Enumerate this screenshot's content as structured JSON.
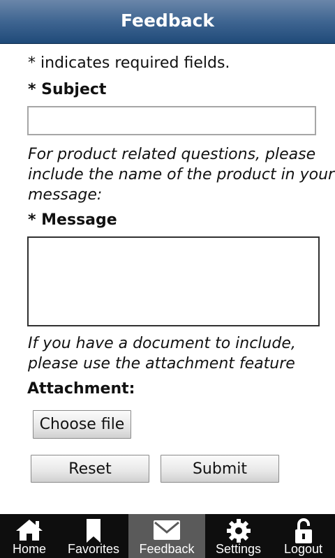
{
  "header": {
    "title": "Feedback"
  },
  "form": {
    "required_note": "* indicates required fields.",
    "subject_label": "* Subject",
    "subject_value": "",
    "product_hint": "For product related questions, please include the name of the product in your message:",
    "message_label": "* Message",
    "message_value": "",
    "document_hint": "If you have a document to include, please use the attachment feature below:",
    "attachment_label": "Attachment:",
    "choose_file_label": "Choose file",
    "reset_label": "Reset",
    "submit_label": "Submit"
  },
  "tabbar": {
    "active_tab": "Feedback",
    "items": [
      {
        "label": "Home",
        "icon": "home-icon"
      },
      {
        "label": "Favorites",
        "icon": "bookmark-icon"
      },
      {
        "label": "Feedback",
        "icon": "envelope-icon"
      },
      {
        "label": "Settings",
        "icon": "gear-icon"
      },
      {
        "label": "Logout",
        "icon": "lock-icon"
      }
    ]
  },
  "colors": {
    "header_top": "#6a86a9",
    "header_bottom": "#1f4a79",
    "tabbar_bg": "#0e0e0e",
    "active_tab_bg": "#5a5a5a"
  }
}
